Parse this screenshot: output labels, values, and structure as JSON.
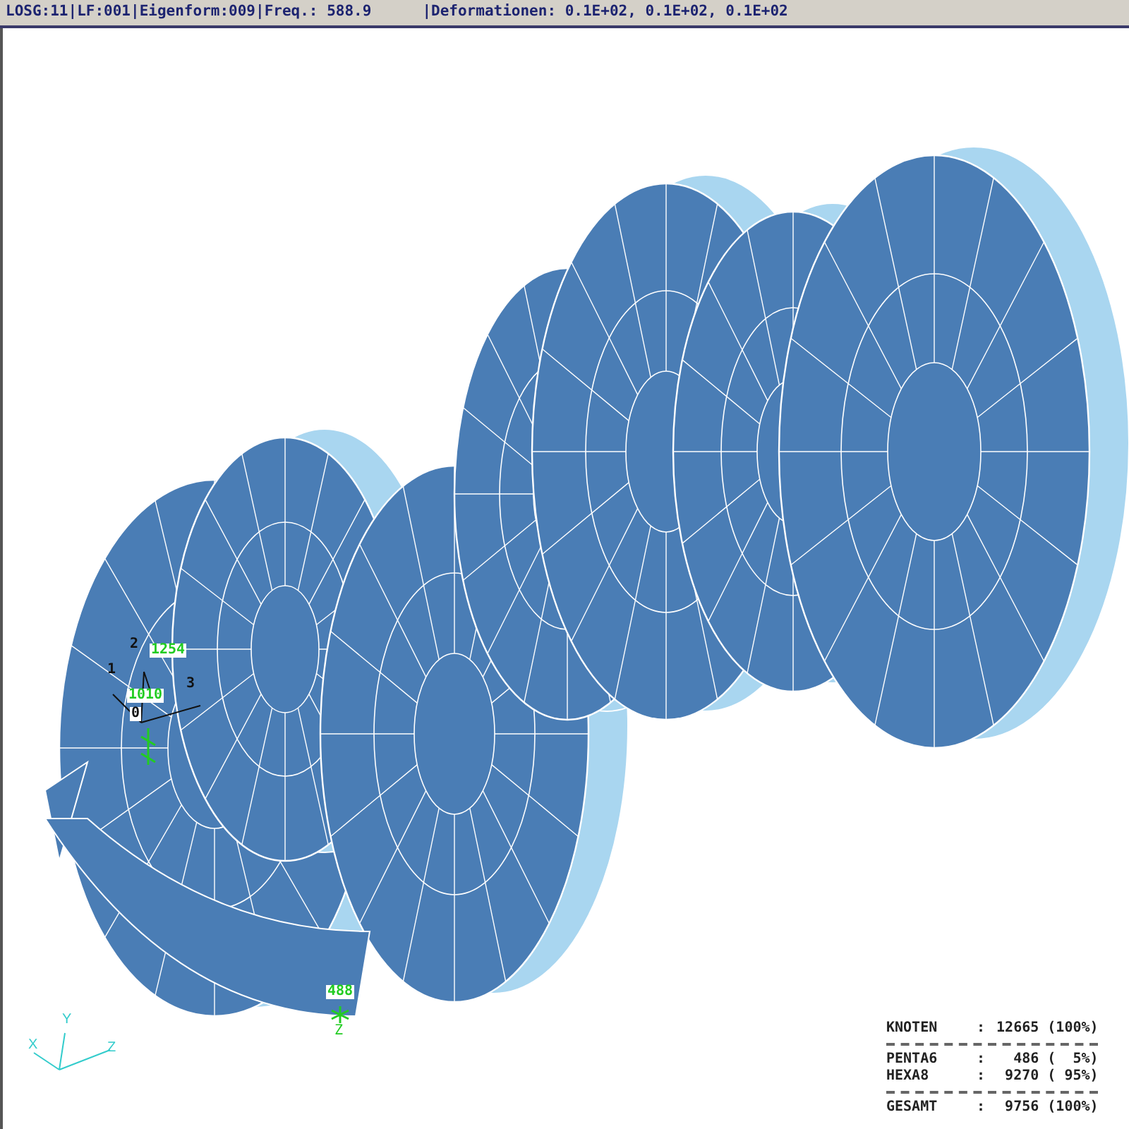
{
  "status_bar": {
    "texts": [
      "LOSG:11|LF:001|Eigenform:009|Freq.: 588.9",
      "|Deformationen: 0.1E+02, 0.1E+02, 0.1E+02"
    ]
  },
  "node_labels": [
    {
      "text": "1254"
    },
    {
      "text": "1010"
    },
    {
      "text": "488"
    }
  ],
  "local_axes": [
    "1",
    "2",
    "3",
    "0"
  ],
  "z_marker": "Z",
  "triad": [
    "X",
    "Y",
    "Z"
  ],
  "stats": [
    {
      "kind": "row",
      "label": "KNOTEN",
      "sep": ":",
      "value": "12665 (100%)"
    },
    {
      "kind": "divider"
    },
    {
      "kind": "row",
      "label": "PENTA6",
      "sep": ":",
      "value": "  486 (  5%)"
    },
    {
      "kind": "row",
      "label": "HEXA8",
      "sep": ":",
      "value": " 9270 ( 95%)"
    },
    {
      "kind": "divider"
    },
    {
      "kind": "row",
      "label": "GESAMT",
      "sep": ":",
      "value": " 9756 (100%)"
    }
  ]
}
